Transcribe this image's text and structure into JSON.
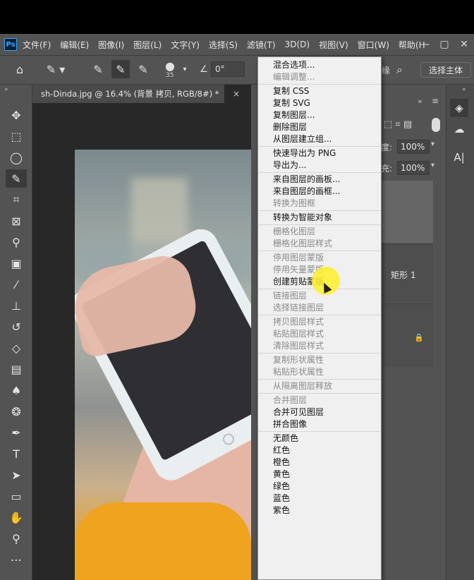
{
  "app": {
    "logo": "Ps",
    "menus": [
      "文件(F)",
      "编辑(E)",
      "图像(I)",
      "图层(L)",
      "文字(Y)",
      "选择(S)",
      "滤镜(T)",
      "3D(D)",
      "视图(V)",
      "窗口(W)",
      "帮助(H"
    ],
    "window_controls": [
      "—",
      "▢",
      "✕"
    ]
  },
  "options_bar": {
    "brush_size": "35",
    "angle_value": "0°",
    "edge_label": "缘",
    "select_subject": "选择主体"
  },
  "document": {
    "tab_title": "sh-Dinda.jpg @ 16.4% (背景 拷贝, RGB/8#) *",
    "close": "×"
  },
  "layers_panel": {
    "opacity_label": "度:",
    "opacity_value": "100%",
    "fill_label": "充:",
    "fill_value": "100%",
    "layer_name": "矩形 1"
  },
  "context_menu": {
    "groups": [
      {
        "items": [
          {
            "label": "混合选项...",
            "enabled": true
          },
          {
            "label": "编辑调整...",
            "enabled": false
          }
        ]
      },
      {
        "items": [
          {
            "label": "复制 CSS",
            "enabled": true
          },
          {
            "label": "复制 SVG",
            "enabled": true
          },
          {
            "label": "复制图层...",
            "enabled": true
          },
          {
            "label": "删除图层",
            "enabled": true
          },
          {
            "label": "从图层建立组...",
            "enabled": true
          }
        ]
      },
      {
        "items": [
          {
            "label": "快速导出为 PNG",
            "enabled": true
          },
          {
            "label": "导出为...",
            "enabled": true
          }
        ]
      },
      {
        "items": [
          {
            "label": "来自图层的画板...",
            "enabled": true
          },
          {
            "label": "来自图层的画框...",
            "enabled": true
          },
          {
            "label": "转换为图框",
            "enabled": false
          }
        ]
      },
      {
        "items": [
          {
            "label": "转换为智能对象",
            "enabled": true
          }
        ]
      },
      {
        "items": [
          {
            "label": "栅格化图层",
            "enabled": false
          },
          {
            "label": "栅格化图层样式",
            "enabled": false
          }
        ]
      },
      {
        "items": [
          {
            "label": "停用图层蒙版",
            "enabled": false
          },
          {
            "label": "停用矢量蒙版",
            "enabled": false
          },
          {
            "label": "创建剪贴蒙版",
            "enabled": true
          }
        ]
      },
      {
        "items": [
          {
            "label": "链接图层",
            "enabled": false
          },
          {
            "label": "选择链接图层",
            "enabled": false
          }
        ]
      },
      {
        "items": [
          {
            "label": "拷贝图层样式",
            "enabled": false
          },
          {
            "label": "粘贴图层样式",
            "enabled": false
          },
          {
            "label": "清除图层样式",
            "enabled": false
          }
        ]
      },
      {
        "items": [
          {
            "label": "复制形状属性",
            "enabled": false
          },
          {
            "label": "粘贴形状属性",
            "enabled": false
          }
        ]
      },
      {
        "items": [
          {
            "label": "从隔离图层释放",
            "enabled": false
          }
        ]
      },
      {
        "items": [
          {
            "label": "合并图层",
            "enabled": false
          },
          {
            "label": "合并可见图层",
            "enabled": true
          },
          {
            "label": "拼合图像",
            "enabled": true
          }
        ]
      },
      {
        "items": [
          {
            "label": "无颜色",
            "enabled": true
          },
          {
            "label": "红色",
            "enabled": true
          },
          {
            "label": "橙色",
            "enabled": true
          },
          {
            "label": "黄色",
            "enabled": true
          },
          {
            "label": "绿色",
            "enabled": true
          },
          {
            "label": "蓝色",
            "enabled": true
          },
          {
            "label": "紫色",
            "enabled": true
          }
        ]
      }
    ]
  },
  "colors": {
    "menu_bg": "#f0f0f0",
    "ui_gray": "#535353",
    "canvas_bg": "#282828",
    "cursor_highlight": "#fff028"
  }
}
